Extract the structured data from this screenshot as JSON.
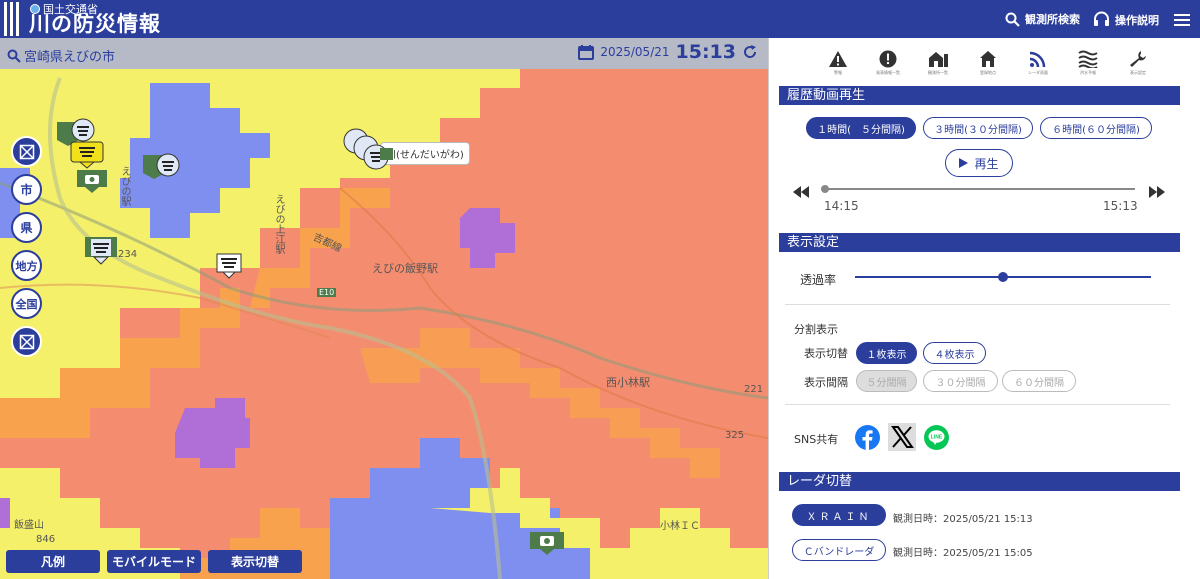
{
  "header": {
    "ministry": "国土交通省",
    "title": "川の防災情報",
    "search_label": "観測所検索",
    "help_label": "操作説明"
  },
  "map": {
    "location": "宮崎県えびの市",
    "date": "2025/05/21",
    "time": "15:13",
    "scale_buttons": [
      "市",
      "県",
      "地方",
      "全国"
    ],
    "tooltip": "川(せんだいがわ)",
    "place_labels": {
      "ebino_station": "えびの駅",
      "ebino_kamie": "えびの上江駅",
      "kyohi_line": "吉都線",
      "iino_station": "えびの飯野駅",
      "nishikobayashi": "西小林駅",
      "elev_325": "325",
      "elev_846": "846",
      "hanmori": "飯盛山",
      "kobayashi_ic": "小林ＩＣ",
      "route_221": "221",
      "route_234": "234",
      "e10": "E10"
    },
    "bottom_buttons": {
      "legend": "凡例",
      "mobile": "モバイルモード",
      "toggle": "表示切替"
    }
  },
  "panel": {
    "tools": [
      {
        "icon": "warning-icon",
        "label": "警報"
      },
      {
        "icon": "info-icon",
        "label": "発表情報一覧"
      },
      {
        "icon": "house-list-icon",
        "label": "観測所一覧"
      },
      {
        "icon": "home-icon",
        "label": "登録地点"
      },
      {
        "icon": "radar-icon",
        "label": "レーダ雨量"
      },
      {
        "icon": "water-icon",
        "label": "洪水予報"
      },
      {
        "icon": "wrench-icon",
        "label": "表示設定"
      }
    ],
    "history": {
      "title": "履歴動画再生",
      "intervals": [
        "１時間(　５分間隔)",
        "３時間(３０分間隔)",
        "６時間(６０分間隔)"
      ],
      "play_label": "再生",
      "start_time": "14:15",
      "end_time": "15:13",
      "progress": 0
    },
    "display": {
      "title": "表示設定",
      "opacity_label": "透過率",
      "opacity_value": 0.5,
      "split_label": "分割表示",
      "switch_label": "表示切替",
      "switch_options": [
        "１枚表示",
        "４枚表示"
      ],
      "interval_label": "表示間隔",
      "interval_options": [
        "５分間隔",
        "３０分間隔",
        "６０分間隔"
      ],
      "sns_label": "SNS共有"
    },
    "radar": {
      "title": "レーダ切替",
      "options": [
        {
          "name": "ＸＲＡＩＮ",
          "observed": "観測日時：2025/05/21 15:13"
        },
        {
          "name": "Ｃバンドレーダ",
          "observed": "観測日時：2025/05/21 15:05"
        }
      ]
    },
    "colors": {
      "brand": "#2b3e9c",
      "rain_yellow": "#f5f06a",
      "rain_orange": "#f9a24e",
      "rain_red": "#f48d6f",
      "rain_blue": "#7f8ff0",
      "rain_purple": "#b06fd6"
    }
  }
}
